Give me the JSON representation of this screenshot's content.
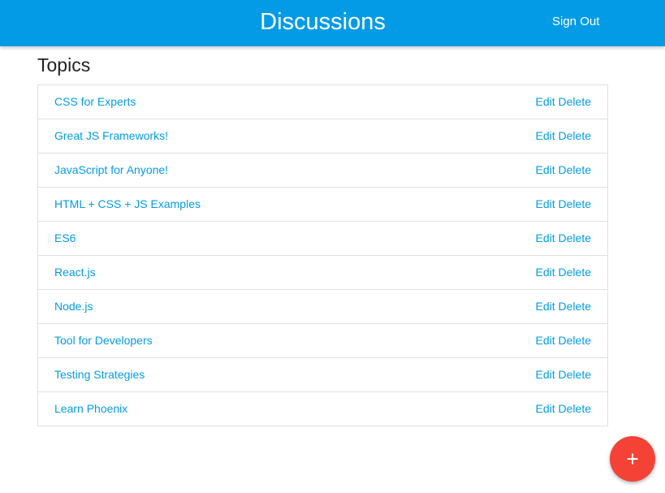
{
  "nav": {
    "brand": "Discussions",
    "sign_out": "Sign Out",
    "bg_color": "#039be5"
  },
  "main": {
    "heading": "Topics",
    "edit_label": "Edit",
    "delete_label": "Delete",
    "topics": [
      "CSS for Experts",
      "Great JS Frameworks!",
      "JavaScript for Anyone!",
      "HTML + CSS + JS Examples",
      "ES6",
      "React.js",
      "Node.js",
      "Tool for Developers",
      "Testing Strategies",
      "Learn Phoenix"
    ]
  },
  "fab": {
    "icon": "plus-icon",
    "color": "#f44336"
  }
}
